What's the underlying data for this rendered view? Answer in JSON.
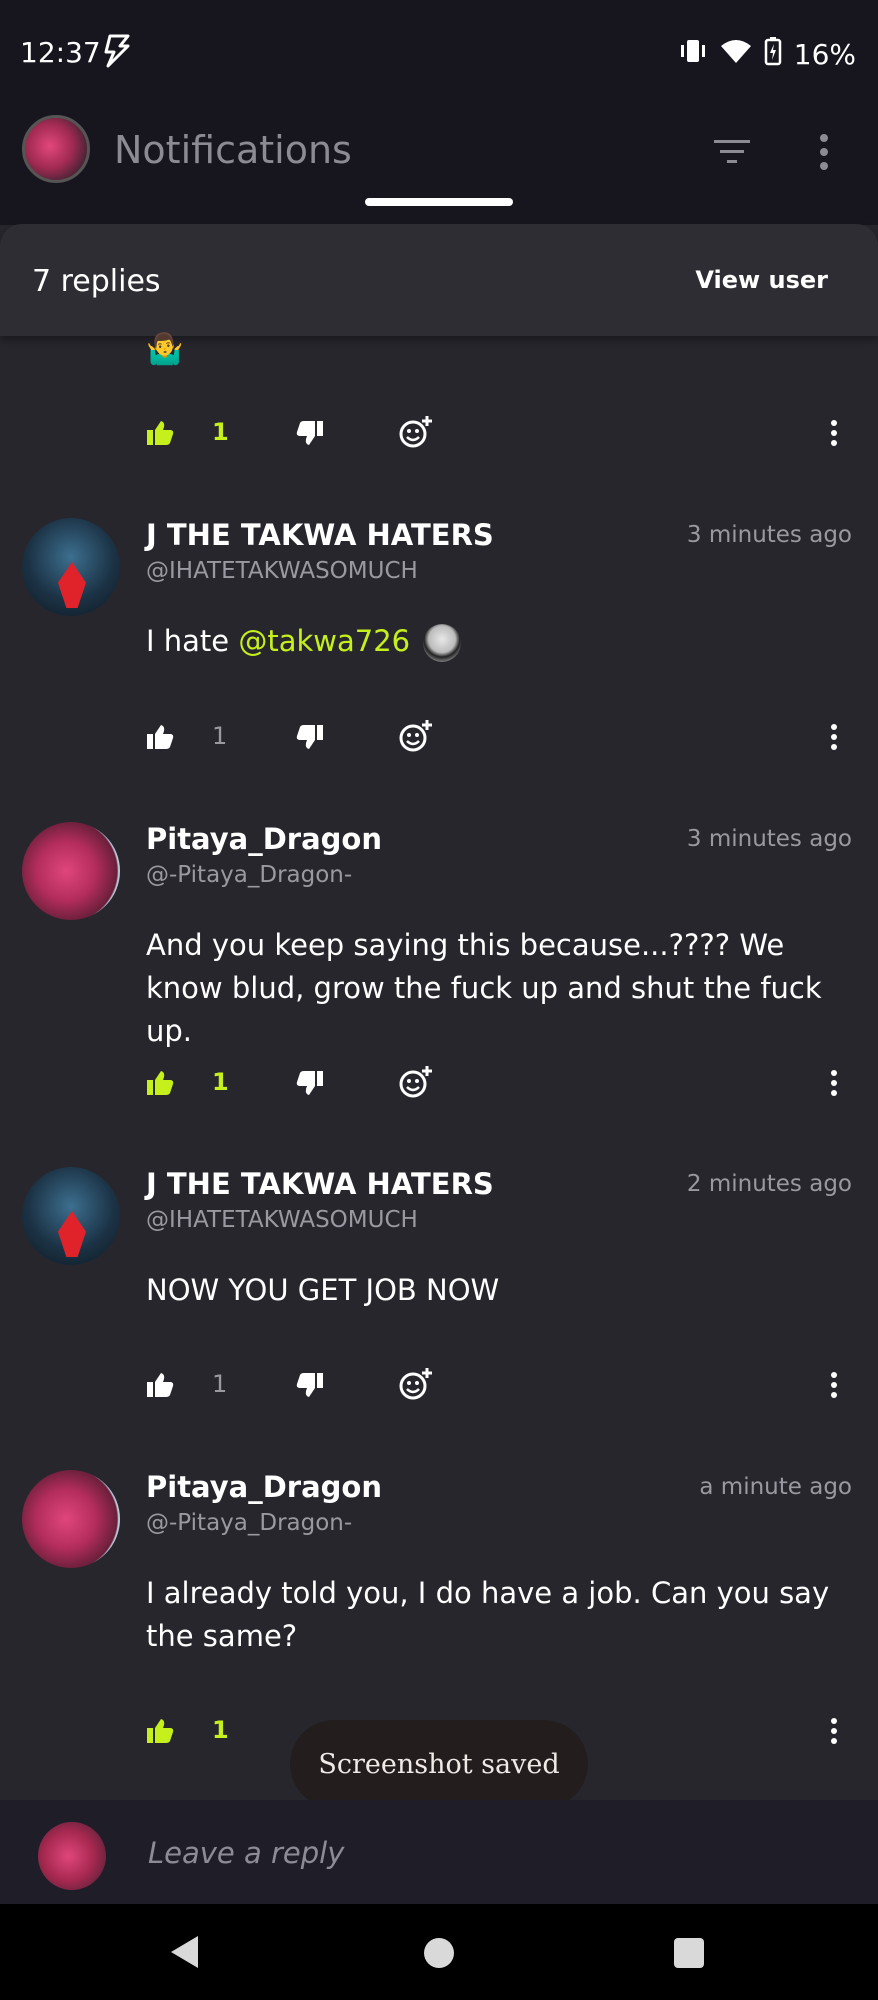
{
  "status_bar": {
    "time": "12:37",
    "battery": "16%"
  },
  "app_bar": {
    "title": "Notifications"
  },
  "sheet": {
    "title": "7 replies",
    "view_user": "View user"
  },
  "top_reply": {
    "emoji": "🤷‍♂️",
    "likes": "1",
    "liked": true
  },
  "comments": [
    {
      "name": "J THE TAKWA HATERS",
      "handle": "@IHATETAKWASOMUCH",
      "time": "3 minutes ago",
      "text_prefix": "I hate ",
      "mention": "@takwa726",
      "likes": "1",
      "liked": false
    },
    {
      "name": "Pitaya_Dragon",
      "handle": "@-Pitaya_Dragon-",
      "time": "3 minutes ago",
      "text": "And you keep saying this because...???? We know blud, grow the fuck up and shut the fuck up.",
      "likes": "1",
      "liked": true
    },
    {
      "name": "J THE TAKWA HATERS",
      "handle": "@IHATETAKWASOMUCH",
      "time": "2 minutes ago",
      "text": "NOW YOU GET JOB NOW",
      "likes": "1",
      "liked": false
    },
    {
      "name": "Pitaya_Dragon",
      "handle": "@-Pitaya_Dragon-",
      "time": "a minute ago",
      "text": "I already told you, I do have a job. Can you say the same?",
      "likes": "1",
      "liked": true
    }
  ],
  "toast": "Screenshot saved",
  "reply_bar": {
    "placeholder": "Leave a reply"
  },
  "colors": {
    "accent": "#c6f01b",
    "background": "#27262d",
    "header": "#17161f"
  }
}
